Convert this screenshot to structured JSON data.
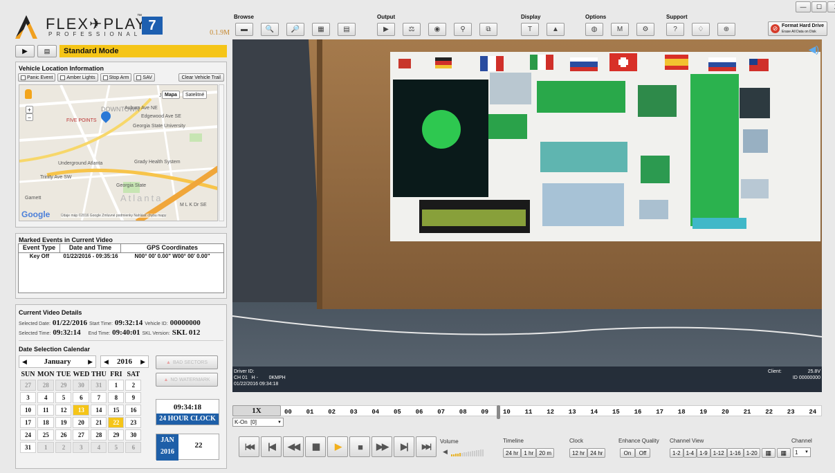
{
  "app": {
    "logo_main": "FLEX✈PLAY",
    "logo_sub": "PROFESSIONAL",
    "logo_tm": "™",
    "logo_version": "7",
    "version": "0.1.9M"
  },
  "mode": {
    "label": "Standard Mode"
  },
  "toolbar": {
    "groups": [
      {
        "label": "Browse",
        "icons": [
          "folder-icon",
          "search-file-icon",
          "search-file-alt-icon",
          "calendar-search-icon",
          "document-icon"
        ]
      },
      {
        "label": "Output",
        "icons": [
          "play-export-icon",
          "scale-icon",
          "camera-icon",
          "map-pin-icon",
          "copy-icon"
        ]
      },
      {
        "label": "Display",
        "icons": [
          "text-overlay-icon",
          "person-overlay-icon"
        ]
      },
      {
        "label": "Options",
        "icons": [
          "globe-icon",
          "memory-icon",
          "settings-icon"
        ]
      },
      {
        "label": "Support",
        "icons": [
          "help-icon",
          "lightbulb-icon",
          "info-icon"
        ]
      }
    ],
    "format": {
      "title": "Format Hard Drive",
      "subtitle": "Erase All Data on Disk"
    }
  },
  "window": {
    "minimize": "—",
    "maximize": "☐",
    "close": "X"
  },
  "vehicle": {
    "title": "Vehicle Location Information",
    "checks": [
      "Panic Event",
      "Amber Lights",
      "Stop Arm",
      "SAV"
    ],
    "clear": "Clear Vehicle Trail",
    "map": {
      "mapa": "Mapa",
      "satellite": "Satelitné",
      "labels": [
        "DOWNTOWN",
        "FIVE POINTS",
        "Auburn Ave NE",
        "Edgewood Ave SE",
        "Georgia State University",
        "Underground Atlanta",
        "Grady Health System",
        "Georgia State",
        "Atlanta",
        "Garnett",
        "Trinity Ave SW",
        "John",
        "M L K Dr SE"
      ],
      "google": "Google",
      "footer": "Údaje máp ©2016 Google   Zmluvné podmienky   Nahlásiť chybu mapy"
    }
  },
  "events": {
    "title": "Marked Events in Current Video",
    "headers": [
      "Event Type",
      "Date and Time",
      "GPS Coordinates"
    ],
    "rows": [
      [
        "Key Off",
        "01/22/2016 - 09:35:16",
        "N00° 00' 0.00\" W00° 00' 0.00\""
      ]
    ]
  },
  "details": {
    "title": "Current Video Details",
    "selected_date_label": "Selected Date:",
    "selected_date": "01/22/2016",
    "start_label": "Start Time:",
    "start": "09:32:14",
    "vehicle_label": "Vehicle ID:",
    "vehicle": "00000000",
    "selected_time_label": "Selected Time:",
    "selected_time": "09:32:14",
    "end_label": "End Time:",
    "end": "09:40:01",
    "skl_label": "SKL Version:",
    "skl": "SKL 012"
  },
  "calendar": {
    "title": "Date Selection Calendar",
    "month": "January",
    "year": "2016",
    "bad_sectors": "BAD SECTORS",
    "no_watermark": "NO WATERMARK",
    "days": [
      "SUN",
      "MON",
      "TUE",
      "WED",
      "THU",
      "FRI",
      "SAT"
    ],
    "weeks": [
      [
        "27",
        "28",
        "29",
        "30",
        "31",
        "1",
        "2"
      ],
      [
        "3",
        "4",
        "5",
        "6",
        "7",
        "8",
        "9"
      ],
      [
        "10",
        "11",
        "12",
        "13",
        "14",
        "15",
        "16"
      ],
      [
        "17",
        "18",
        "19",
        "20",
        "21",
        "22",
        "23"
      ],
      [
        "24",
        "25",
        "26",
        "27",
        "28",
        "29",
        "30"
      ],
      [
        "31",
        "1",
        "2",
        "3",
        "4",
        "5",
        "6"
      ]
    ],
    "clock_time": "09:34:18",
    "clock_mode": "24 HOUR CLOCK",
    "date_month": "JAN",
    "date_year": "2016",
    "date_day": "22"
  },
  "video": {
    "driver": "Driver ID:",
    "ch": "CH 01   H -        0KMPH",
    "timestamp": "01/22/2016 09:34:18",
    "client": "Client:",
    "voltage": "25.8V",
    "id": "ID 00000000"
  },
  "timeline": {
    "speed": "1X",
    "hours": [
      "00",
      "01",
      "02",
      "03",
      "04",
      "05",
      "06",
      "07",
      "08",
      "09",
      "10",
      "11",
      "12",
      "13",
      "14",
      "15",
      "16",
      "17",
      "18",
      "19",
      "20",
      "21",
      "22",
      "23",
      "24"
    ],
    "key_select": "K-On  [0]",
    "position_hour": 9.6
  },
  "controls": {
    "volume": "Volume",
    "volume_level": 0.3,
    "timeline_label": "Timeline",
    "timeline_opts": [
      "24 hr",
      "1 hr",
      "20 m"
    ],
    "clock_label": "Clock",
    "clock_opts": [
      "12 hr",
      "24 hr"
    ],
    "enhance_label": "Enhance Quality",
    "enhance_opts": [
      "On",
      "Off"
    ],
    "channel_view_label": "Channel View",
    "channel_view_opts": [
      "1-2",
      "1-4",
      "1-9",
      "1-12",
      "1-16",
      "1-20"
    ],
    "channel_label": "Channel",
    "channel_value": "1"
  },
  "colors": {
    "accent_yellow": "#f5c518",
    "clock_blue": "#1e5fa8",
    "format_red": "#d63b2a"
  }
}
